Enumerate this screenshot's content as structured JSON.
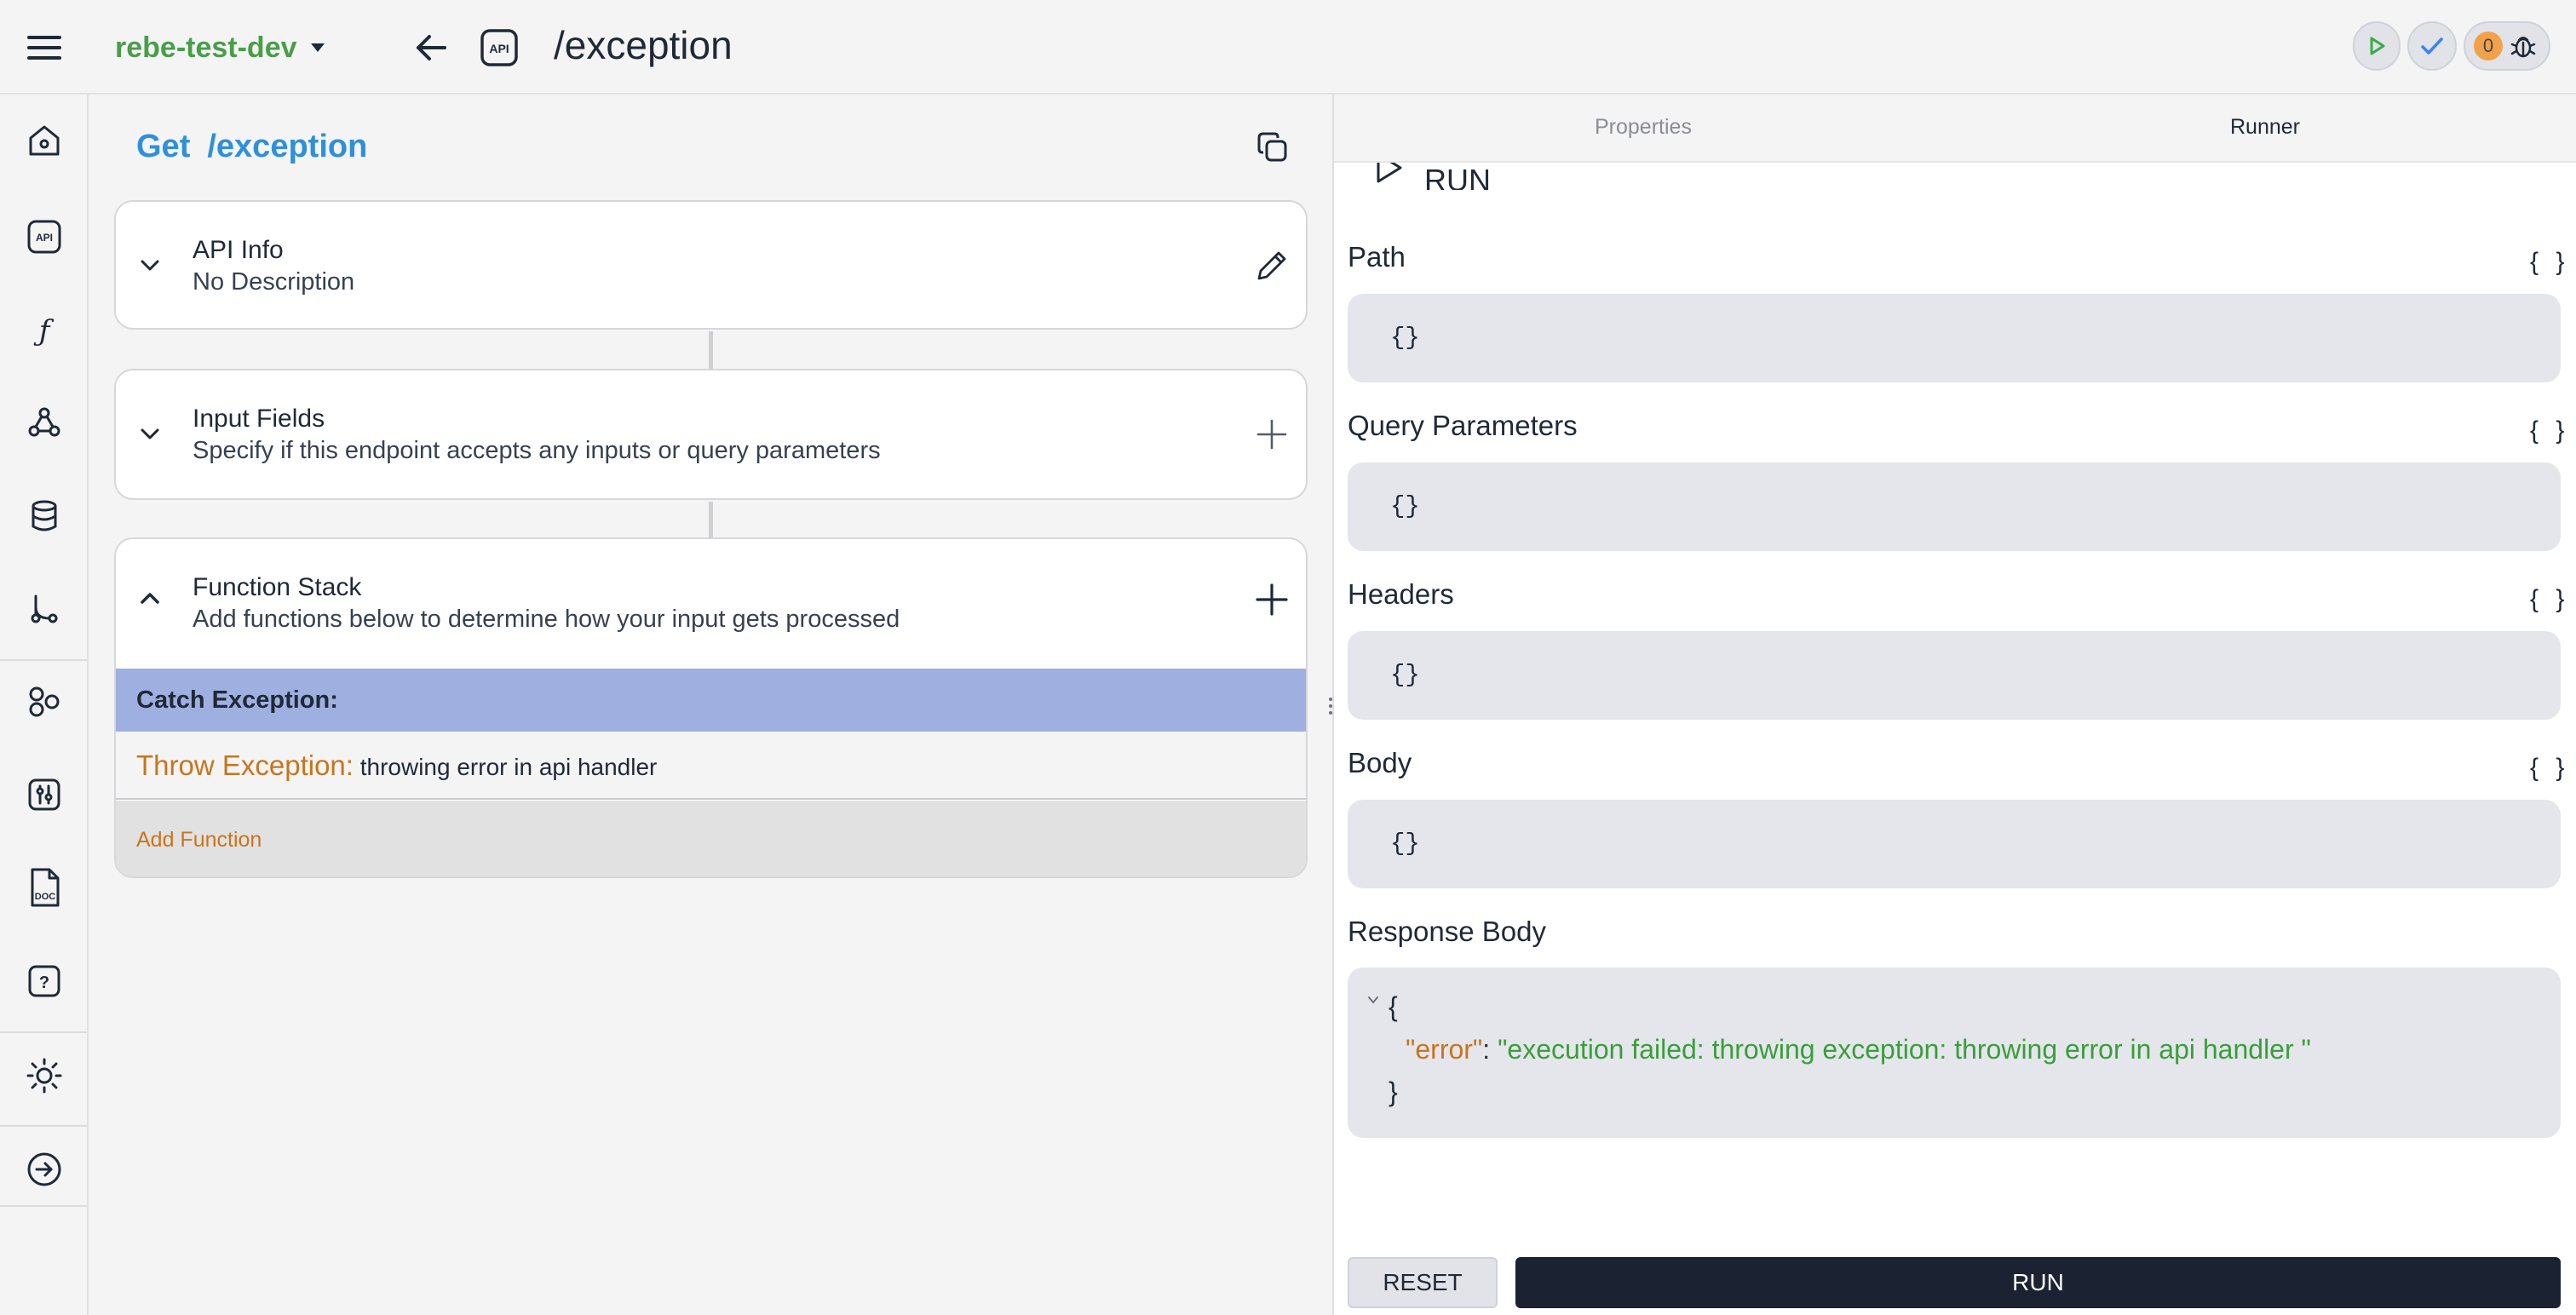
{
  "topbar": {
    "workspace": "rebe-test-dev",
    "api_badge": "API",
    "route": "/exception",
    "debug_count": "0"
  },
  "rail": {
    "items": [
      {
        "icon": "home-icon"
      },
      {
        "icon": "api-icon",
        "label": "API"
      },
      {
        "icon": "function-icon",
        "label": "ƒ"
      },
      {
        "icon": "webhook-icon"
      },
      {
        "icon": "database-icon"
      },
      {
        "icon": "git-branch-icon"
      },
      {
        "icon": "components-icon"
      },
      {
        "icon": "settings-sliders-icon"
      },
      {
        "icon": "docs-icon",
        "label": "DOC"
      },
      {
        "icon": "help-icon",
        "label": "?"
      },
      {
        "icon": "theme-sun-icon"
      },
      {
        "icon": "logout-icon"
      }
    ]
  },
  "endpoint": {
    "method": "Get",
    "path": "/exception"
  },
  "cards": {
    "api_info": {
      "title": "API Info",
      "subtitle": "No Description"
    },
    "input_fields": {
      "title": "Input Fields",
      "subtitle": "Specify if this endpoint accepts any inputs or query parameters"
    },
    "function_stack": {
      "title": "Function Stack",
      "subtitle": "Add functions below to determine how your input gets processed"
    }
  },
  "function_stack": {
    "catch_label": "Catch Exception:",
    "throw_label": "Throw Exception:",
    "throw_message": "throwing error in api handler",
    "add_function": "Add Function"
  },
  "runner": {
    "tabs": {
      "properties": "Properties",
      "runner": "Runner"
    },
    "run_heading": "RUN",
    "brace_glyph": "{ }",
    "sections": {
      "path": {
        "label": "Path",
        "value": "{}"
      },
      "query": {
        "label": "Query Parameters",
        "value": "{}"
      },
      "headers": {
        "label": "Headers",
        "value": "{}"
      },
      "body": {
        "label": "Body",
        "value": "{}"
      }
    },
    "response": {
      "label": "Response Body",
      "open_brace": "{",
      "key": "\"error\"",
      "colon": ":",
      "value": "\"execution failed: throwing exception: throwing error in api handler \"",
      "close_brace": "}"
    },
    "reset_label": "RESET",
    "run_label": "RUN"
  },
  "colors": {
    "accent_blue": "#2f8fdc",
    "workspace_green": "#4a9d4a",
    "orange": "#c8751c",
    "catch_row": "#9fafdf",
    "run_button": "#1b2231"
  }
}
